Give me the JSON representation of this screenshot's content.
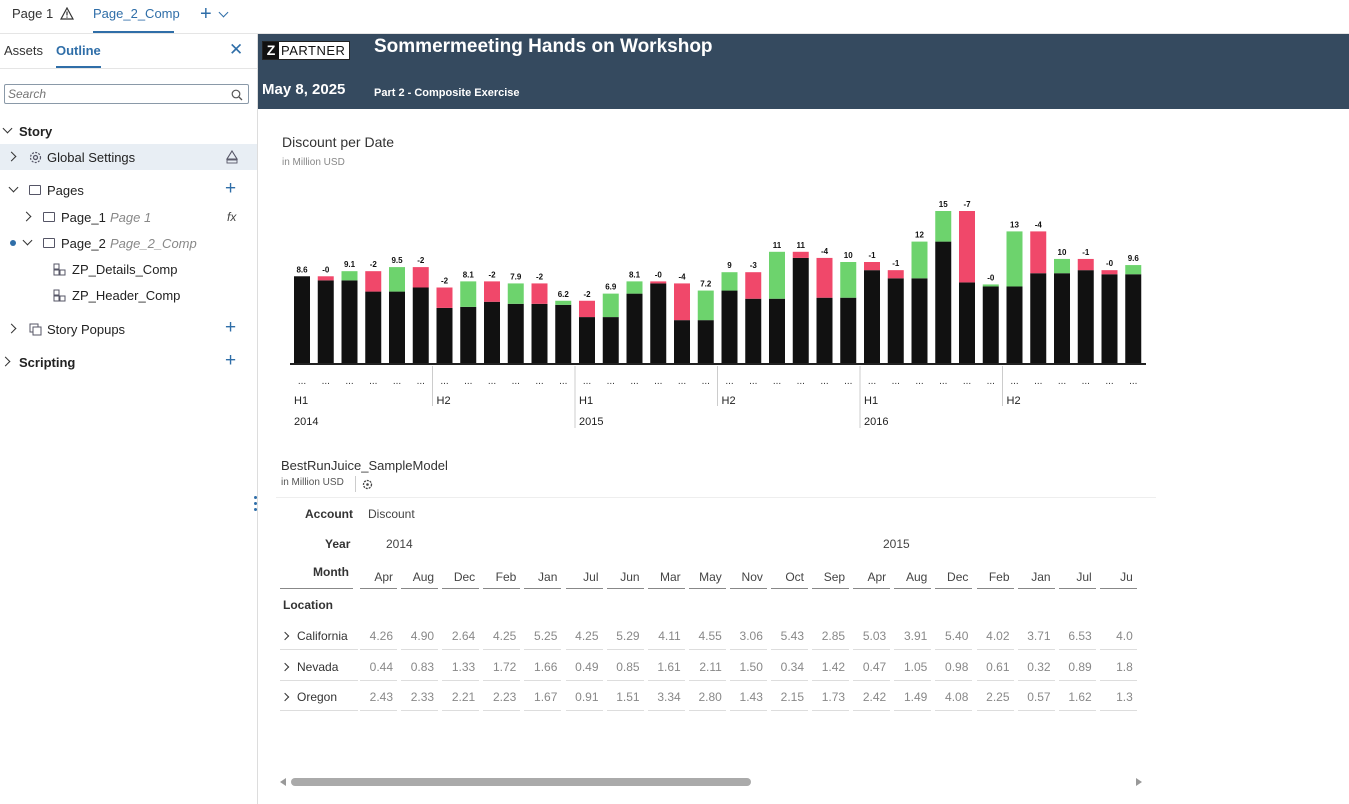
{
  "tabs": {
    "page1": "Page 1",
    "page2": "Page_2_Comp"
  },
  "sidebar": {
    "assets_tab": "Assets",
    "outline_tab": "Outline",
    "search_placeholder": "Search",
    "tree": {
      "story": "Story",
      "global_settings": "Global Settings",
      "pages": "Pages",
      "page1_name": "Page_1",
      "page1_title": "Page 1",
      "page2_name": "Page_2",
      "page2_title": "Page_2_Comp",
      "details_comp": "ZP_Details_Comp",
      "header_comp": "ZP_Header_Comp",
      "story_popups": "Story Popups",
      "scripting": "Scripting"
    }
  },
  "header": {
    "logo_z": "Z",
    "logo_partner": "PARTNER",
    "title": "Sommermeeting Hands on Workshop",
    "date": "May 8, 2025",
    "subtitle": "Part 2 - Composite Exercise"
  },
  "chart_data": {
    "type": "bar",
    "title": "Discount per Date",
    "subtitle": "in Million USD",
    "periods": [
      {
        "half": "H1",
        "year": "2014"
      },
      {
        "half": "H2",
        "year": ""
      },
      {
        "half": "H1",
        "year": "2015"
      },
      {
        "half": "H2",
        "year": ""
      },
      {
        "half": "H1",
        "year": "2016"
      },
      {
        "half": "H2",
        "year": ""
      }
    ],
    "tick_label": "...",
    "bars": [
      {
        "base": 8.6,
        "delta": 0,
        "label": "8.6"
      },
      {
        "base": 8.6,
        "delta": -0.4,
        "label": "-0"
      },
      {
        "base": 8.2,
        "delta": 0.9,
        "label": "9.1"
      },
      {
        "base": 9.1,
        "delta": -2,
        "label": "-2"
      },
      {
        "base": 7.1,
        "delta": 2.4,
        "label": "9.5"
      },
      {
        "base": 9.5,
        "delta": -2,
        "label": "-2"
      },
      {
        "base": 7.5,
        "delta": -2,
        "label": "-2"
      },
      {
        "base": 5.6,
        "delta": 2.5,
        "label": "8.1"
      },
      {
        "base": 8.1,
        "delta": -2,
        "label": "-2"
      },
      {
        "base": 5.9,
        "delta": 2,
        "label": "7.9"
      },
      {
        "base": 7.9,
        "delta": -2,
        "label": "-2"
      },
      {
        "base": 5.8,
        "delta": 0.4,
        "label": "6.2"
      },
      {
        "base": 6.2,
        "delta": -1.6,
        "label": "-2"
      },
      {
        "base": 4.6,
        "delta": 2.3,
        "label": "6.9"
      },
      {
        "base": 6.9,
        "delta": 1.2,
        "label": "8.1"
      },
      {
        "base": 8.1,
        "delta": -0.2,
        "label": "-0"
      },
      {
        "base": 7.9,
        "delta": -3.6,
        "label": "-4"
      },
      {
        "base": 4.3,
        "delta": 2.9,
        "label": "7.2"
      },
      {
        "base": 7.2,
        "delta": 1.8,
        "label": "9"
      },
      {
        "base": 9,
        "delta": -2.6,
        "label": "-3"
      },
      {
        "base": 6.4,
        "delta": 4.6,
        "label": "11"
      },
      {
        "base": 11,
        "delta": -0.6,
        "label": "11"
      },
      {
        "base": 10.4,
        "delta": -3.9,
        "label": "-4"
      },
      {
        "base": 6.5,
        "delta": 3.5,
        "label": "10"
      },
      {
        "base": 10,
        "delta": -0.8,
        "label": "-1"
      },
      {
        "base": 9.2,
        "delta": -0.8,
        "label": "-1"
      },
      {
        "base": 8.4,
        "delta": 3.6,
        "label": "12"
      },
      {
        "base": 12,
        "delta": 3,
        "label": "15"
      },
      {
        "base": 15,
        "delta": -7,
        "label": "-7"
      },
      {
        "base": 7.6,
        "delta": 0.2,
        "label": "-0"
      },
      {
        "base": 7.6,
        "delta": 5.4,
        "label": "13"
      },
      {
        "base": 13,
        "delta": -4.1,
        "label": "-4"
      },
      {
        "base": 8.9,
        "delta": 1.4,
        "label": "10"
      },
      {
        "base": 10.3,
        "delta": -1.1,
        "label": "-1"
      },
      {
        "base": 9.2,
        "delta": -0.4,
        "label": "-0"
      },
      {
        "base": 8.8,
        "delta": 0.9,
        "label": "9.6"
      }
    ],
    "colors": {
      "base": "#111111",
      "increase": "#6dd36d",
      "decrease": "#f0486a"
    },
    "ylim": [
      0,
      16
    ]
  },
  "table": {
    "title": "BestRunJuice_SampleModel",
    "subtitle": "in Million USD",
    "account_label": "Account",
    "account_value": "Discount",
    "year_label": "Year",
    "year_2014": "2014",
    "year_2015": "2015",
    "month_label": "Month",
    "location_label": "Location",
    "months": [
      "Apr",
      "Aug",
      "Dec",
      "Feb",
      "Jan",
      "Jul",
      "Jun",
      "Mar",
      "May",
      "Nov",
      "Oct",
      "Sep",
      "Apr",
      "Aug",
      "Dec",
      "Feb",
      "Jan",
      "Jul",
      "Ju"
    ],
    "rows": [
      {
        "location": "California",
        "values": [
          "4.26",
          "4.90",
          "2.64",
          "4.25",
          "5.25",
          "4.25",
          "5.29",
          "4.11",
          "4.55",
          "3.06",
          "5.43",
          "2.85",
          "5.03",
          "3.91",
          "5.40",
          "4.02",
          "3.71",
          "6.53",
          "4.0"
        ]
      },
      {
        "location": "Nevada",
        "values": [
          "0.44",
          "0.83",
          "1.33",
          "1.72",
          "1.66",
          "0.49",
          "0.85",
          "1.61",
          "2.11",
          "1.50",
          "0.34",
          "1.42",
          "0.47",
          "1.05",
          "0.98",
          "0.61",
          "0.32",
          "0.89",
          "1.8"
        ]
      },
      {
        "location": "Oregon",
        "values": [
          "2.43",
          "2.33",
          "2.21",
          "2.23",
          "1.67",
          "0.91",
          "1.51",
          "3.34",
          "2.80",
          "1.43",
          "2.15",
          "1.73",
          "2.42",
          "1.49",
          "4.08",
          "2.25",
          "0.57",
          "1.62",
          "1.3"
        ]
      }
    ]
  }
}
